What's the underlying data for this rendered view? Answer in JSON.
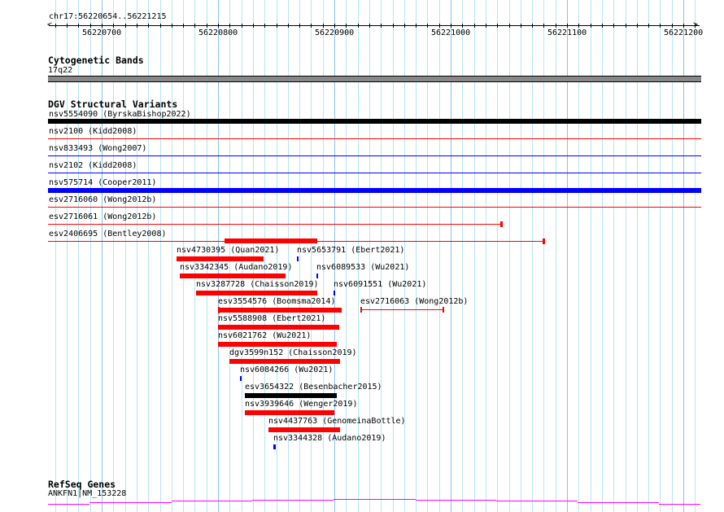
{
  "colors": {
    "loss": "#ff0000",
    "gain": "#0000ff",
    "both": "#000000",
    "gene": "#ff00ff",
    "band": "#888888"
  },
  "ruler": {
    "location": "chr17:56220654..56221215",
    "ticks": [
      "56220700",
      "56220800",
      "56220900",
      "56221000",
      "56221100",
      "56221200"
    ]
  },
  "cytoband": {
    "title": "Cytogenetic Bands",
    "band": "17q22"
  },
  "dgv": {
    "title": "DGV Structural Variants",
    "full_rows": [
      {
        "label": "nsv5554090 (ByrskaBishop2022)",
        "type": "both"
      },
      {
        "label": "nsv2100 (Kidd2008)",
        "type": "loss"
      },
      {
        "label": "nsv833493 (Wong2007)",
        "type": "gain"
      },
      {
        "label": "nsv2102 (Kidd2008)",
        "type": "gain"
      },
      {
        "label": "nsv575714 (Cooper2011)",
        "type": "gain"
      },
      {
        "label": "esv2716060 (Wong2012b)",
        "type": "loss"
      },
      {
        "label": "esv2716061 (Wong2012b)",
        "type": "loss"
      },
      {
        "label": "esv2406695 (Bentley2008)",
        "type": "loss"
      }
    ],
    "stacked": [
      {
        "label": "nsv4730395 (Quan2021)",
        "type": "loss"
      },
      {
        "label": "nsv5653791 (Ebert2021)",
        "type": "gain"
      },
      {
        "label": "nsv3342345 (Audano2019)",
        "type": "loss"
      },
      {
        "label": "nsv6089533 (Wu2021)",
        "type": "gain"
      },
      {
        "label": "nsv3287728 (Chaisson2019)",
        "type": "loss"
      },
      {
        "label": "nsv6091551 (Wu2021)",
        "type": "gain"
      },
      {
        "label": "esv3554576 (Boomsma2014)",
        "type": "loss"
      },
      {
        "label": "esv2716063 (Wong2012b)",
        "type": "loss"
      },
      {
        "label": "nsv5588908 (Ebert2021)",
        "type": "loss"
      },
      {
        "label": "nsv6021762 (Wu2021)",
        "type": "loss"
      },
      {
        "label": "dgv3599n152 (Chaisson2019)",
        "type": "loss"
      },
      {
        "label": "nsv6084266 (Wu2021)",
        "type": "gain"
      },
      {
        "label": "esv3654322 (Besenbacher2015)",
        "type": "both"
      },
      {
        "label": "nsv3939646 (Wenger2019)",
        "type": "loss"
      },
      {
        "label": "nsv4437763 (GenomeinaBottle)",
        "type": "loss"
      },
      {
        "label": "nsv3344328 (Audano2019)",
        "type": "gain"
      }
    ]
  },
  "refseq": {
    "title": "RefSeq Genes",
    "gene": "ANKFN1|NM_153228"
  }
}
